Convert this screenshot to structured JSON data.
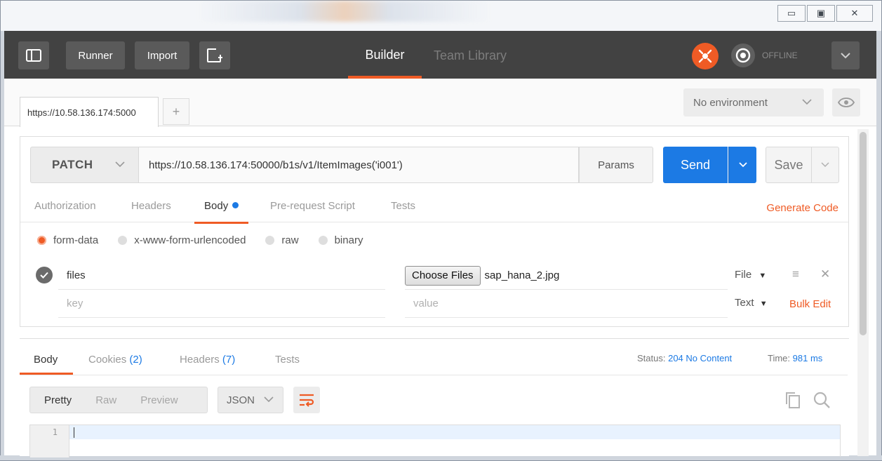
{
  "window": {
    "minimize_glyph": "▭",
    "maximize_glyph": "▣",
    "close_glyph": "✕"
  },
  "header": {
    "runner_label": "Runner",
    "import_label": "Import",
    "tabs": [
      {
        "label": "Builder",
        "active": true
      },
      {
        "label": "Team Library",
        "active": false
      }
    ],
    "status_label": "OFFLINE",
    "accent_color": "#ef5b25"
  },
  "request_tabs": {
    "active_tab_label": "https://10.58.136.174:5000",
    "add_tab_label": "+"
  },
  "environment": {
    "selected": "No environment"
  },
  "request": {
    "method": "PATCH",
    "url": "https://10.58.136.174:50000/b1s/v1/ItemImages('i001')",
    "params_label": "Params",
    "send_label": "Send",
    "save_label": "Save"
  },
  "request_subtabs": {
    "tabs": [
      "Authorization",
      "Headers",
      "Body",
      "Pre-request Script",
      "Tests"
    ],
    "active": "Body",
    "generate_code_label": "Generate Code"
  },
  "body_modes": {
    "options": [
      "form-data",
      "x-www-form-urlencoded",
      "raw",
      "binary"
    ],
    "selected": "form-data"
  },
  "form_rows": [
    {
      "key": "files",
      "choose_label": "Choose Files",
      "file_name": "sap_hana_2.jpg",
      "type": "File"
    },
    {
      "key_placeholder": "key",
      "value_placeholder": "value",
      "type": "Text"
    }
  ],
  "bulk_edit_label": "Bulk Edit",
  "response": {
    "tabs": [
      {
        "label": "Body",
        "count": ""
      },
      {
        "label": "Cookies",
        "count": "(2)"
      },
      {
        "label": "Headers",
        "count": "(7)"
      },
      {
        "label": "Tests",
        "count": ""
      }
    ],
    "status_label": "Status:",
    "status_value": "204 No Content",
    "time_label": "Time:",
    "time_value": "981 ms",
    "view_modes": [
      "Pretty",
      "Raw",
      "Preview"
    ],
    "active_view": "Pretty",
    "language": "JSON",
    "line_numbers": [
      "1"
    ]
  }
}
